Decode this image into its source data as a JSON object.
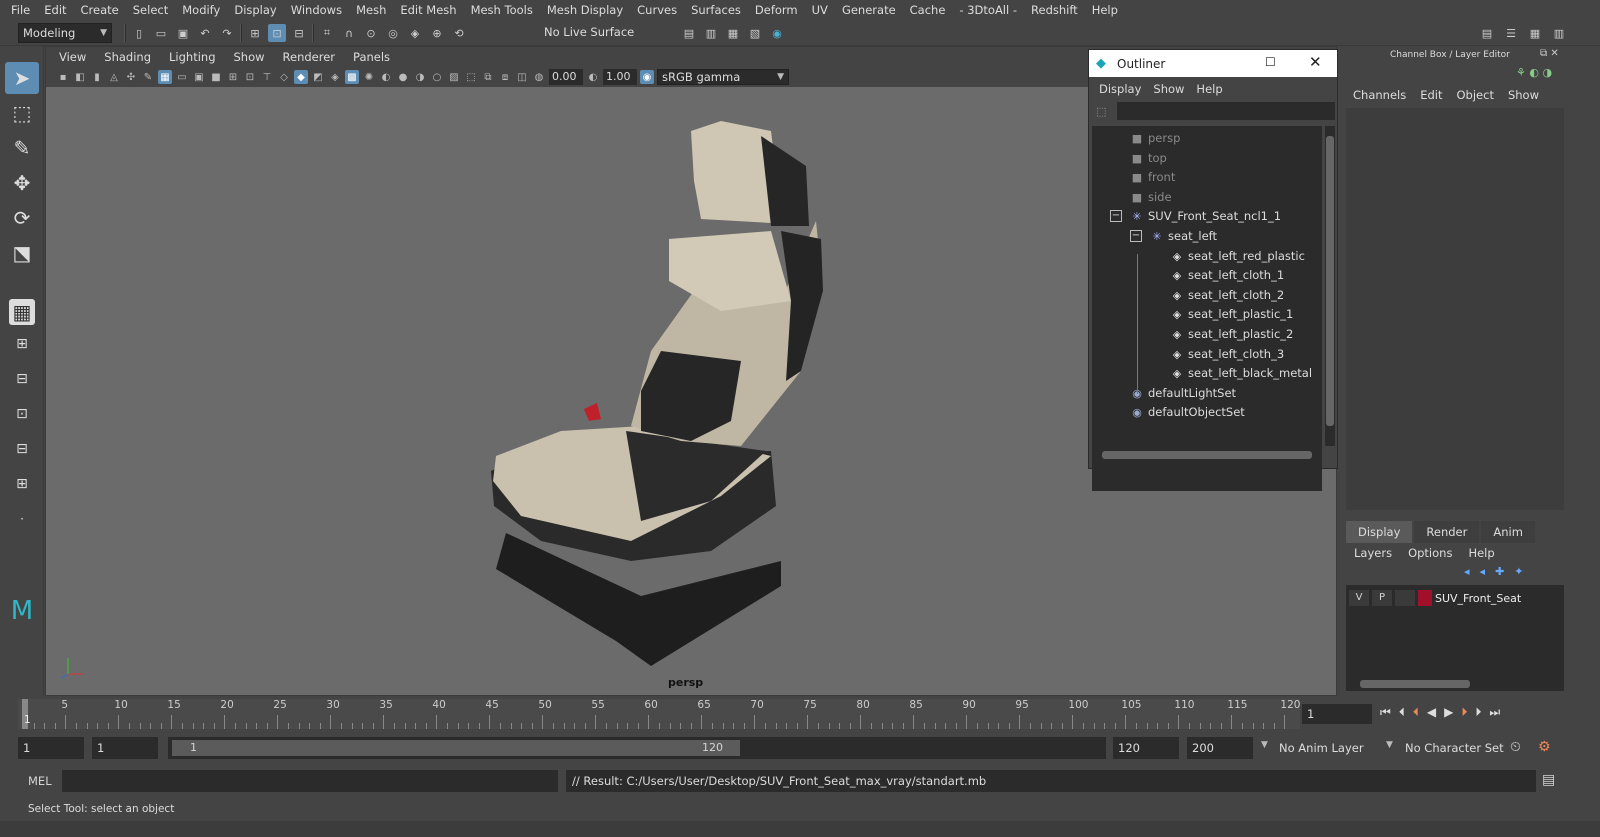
{
  "menubar": [
    "File",
    "Edit",
    "Create",
    "Select",
    "Modify",
    "Display",
    "Windows",
    "Mesh",
    "Edit Mesh",
    "Mesh Tools",
    "Mesh Display",
    "Curves",
    "Surfaces",
    "Deform",
    "UV",
    "Generate",
    "Cache",
    "- 3DtoAll -",
    "Redshift",
    "Help"
  ],
  "shelf": {
    "mode": "Modeling",
    "live_surface": "No Live Surface"
  },
  "viewport": {
    "menu": [
      "View",
      "Shading",
      "Lighting",
      "Show",
      "Renderer",
      "Panels"
    ],
    "exposure": "0.00",
    "gamma": "1.00",
    "colorspace": "sRGB gamma",
    "camera_label": "persp"
  },
  "outliner": {
    "title": "Outliner",
    "menu": [
      "Display",
      "Show",
      "Help"
    ],
    "items": [
      {
        "label": "persp",
        "icon": "camera-icon",
        "dim": true
      },
      {
        "label": "top",
        "icon": "camera-icon",
        "dim": true
      },
      {
        "label": "front",
        "icon": "camera-icon",
        "dim": true
      },
      {
        "label": "side",
        "icon": "camera-icon",
        "dim": true
      },
      {
        "label": "SUV_Front_Seat_ncl1_1",
        "icon": "group-icon",
        "dim": false
      },
      {
        "label": "seat_left",
        "icon": "group-icon",
        "dim": false
      },
      {
        "label": "seat_left_red_plastic",
        "icon": "mesh-icon",
        "dim": false
      },
      {
        "label": "seat_left_cloth_1",
        "icon": "mesh-icon",
        "dim": false
      },
      {
        "label": "seat_left_cloth_2",
        "icon": "mesh-icon",
        "dim": false
      },
      {
        "label": "seat_left_plastic_1",
        "icon": "mesh-icon",
        "dim": false
      },
      {
        "label": "seat_left_plastic_2",
        "icon": "mesh-icon",
        "dim": false
      },
      {
        "label": "seat_left_cloth_3",
        "icon": "mesh-icon",
        "dim": false
      },
      {
        "label": "seat_left_black_metal",
        "icon": "mesh-icon",
        "dim": false
      },
      {
        "label": "defaultLightSet",
        "icon": "set-icon",
        "dim": false
      },
      {
        "label": "defaultObjectSet",
        "icon": "set-icon",
        "dim": false
      }
    ]
  },
  "channelbox": {
    "title": "Channel Box / Layer Editor",
    "menu": [
      "Channels",
      "Edit",
      "Object",
      "Show"
    ]
  },
  "layers": {
    "tabs": [
      "Display",
      "Render",
      "Anim"
    ],
    "menu": [
      "Layers",
      "Options",
      "Help"
    ],
    "row": {
      "v": "V",
      "p": "P",
      "name": "SUV_Front_Seat",
      "color": "#a0102a"
    }
  },
  "timeline": {
    "ticks": [
      "5",
      "10",
      "15",
      "20",
      "25",
      "30",
      "35",
      "40",
      "45",
      "50",
      "55",
      "60",
      "65",
      "70",
      "75",
      "80",
      "85",
      "90",
      "95",
      "100",
      "105",
      "110",
      "115",
      "120"
    ],
    "start_label": "1",
    "current": "1"
  },
  "range": {
    "start": "1",
    "start2": "1",
    "slider_start": "1",
    "slider_end": "120",
    "end": "120",
    "end2": "200",
    "anim_layer": "No Anim Layer",
    "char_set": "No Character Set"
  },
  "mel": {
    "label": "MEL",
    "result": "// Result: C:/Users/User/Desktop/SUV_Front_Seat_max_vray/standart.mb"
  },
  "help": "Select Tool: select an object"
}
